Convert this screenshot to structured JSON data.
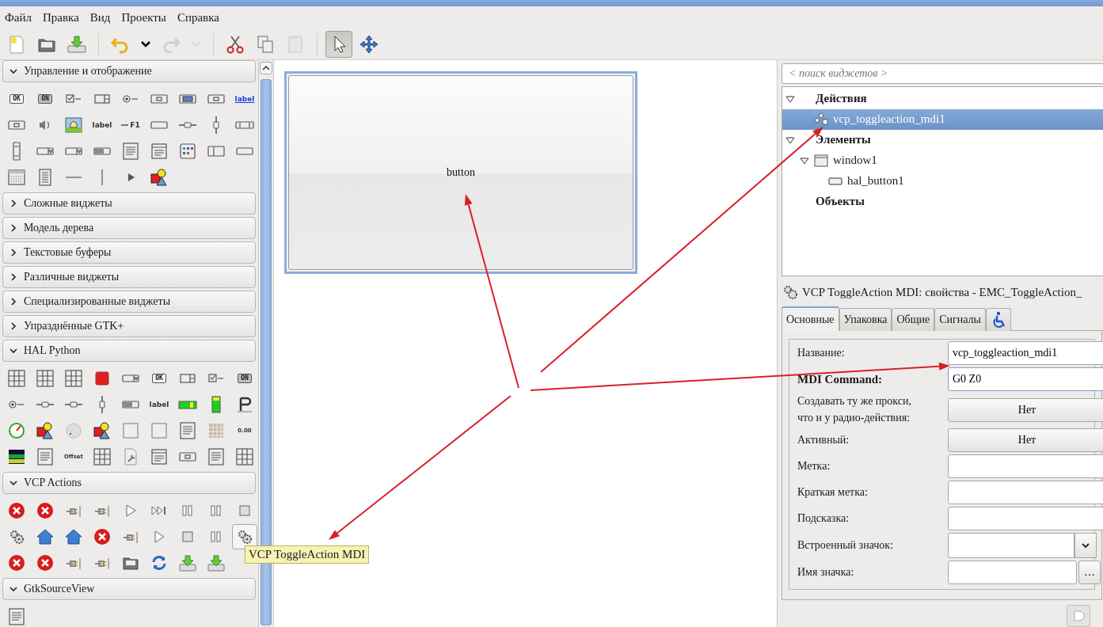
{
  "menu": [
    {
      "label": "Файл"
    },
    {
      "label": "Правка"
    },
    {
      "label": "Вид"
    },
    {
      "label": "Проекты"
    },
    {
      "label": "Справка"
    }
  ],
  "toolbar": [
    {
      "kind": "new",
      "disabled": false,
      "selected": false
    },
    {
      "kind": "open",
      "disabled": false,
      "selected": false
    },
    {
      "kind": "save",
      "disabled": false,
      "selected": false
    },
    {
      "kind": "separator"
    },
    {
      "kind": "undo",
      "disabled": false,
      "selected": false
    },
    {
      "kind": "caret",
      "disabled": false,
      "selected": false
    },
    {
      "kind": "redo",
      "disabled": true,
      "selected": false
    },
    {
      "kind": "caret",
      "disabled": true,
      "selected": false
    },
    {
      "kind": "separator"
    },
    {
      "kind": "cut",
      "disabled": false,
      "selected": false
    },
    {
      "kind": "copy",
      "disabled": false,
      "selected": false
    },
    {
      "kind": "paste",
      "disabled": true,
      "selected": false
    },
    {
      "kind": "separator"
    },
    {
      "kind": "pointer",
      "disabled": false,
      "selected": true
    },
    {
      "kind": "move",
      "disabled": false,
      "selected": false
    }
  ],
  "palette": [
    {
      "title": "Управление и отображение",
      "expanded": true,
      "items": [
        {
          "kind": "button",
          "text": "OK"
        },
        {
          "kind": "toggle",
          "text": "ON"
        },
        {
          "kind": "check"
        },
        {
          "kind": "spin"
        },
        {
          "kind": "radio"
        },
        {
          "kind": "framebtn"
        },
        {
          "kind": "colorbtn"
        },
        {
          "kind": "fontbtn"
        },
        {
          "kind": "link",
          "text": "label"
        },
        {
          "kind": "scalebtn"
        },
        {
          "kind": "volume"
        },
        {
          "kind": "image"
        },
        {
          "kind": "label",
          "text": "label"
        },
        {
          "kind": "accel",
          "text": "F1"
        },
        {
          "kind": "entry"
        },
        {
          "kind": "hscale"
        },
        {
          "kind": "vscale"
        },
        {
          "kind": "hscroll"
        },
        {
          "kind": "vscroll"
        },
        {
          "kind": "combo"
        },
        {
          "kind": "combo"
        },
        {
          "kind": "progress"
        },
        {
          "kind": "doc"
        },
        {
          "kind": "window"
        },
        {
          "kind": "iconview"
        },
        {
          "kind": "paned"
        },
        {
          "kind": "bar"
        },
        {
          "kind": "calendar"
        },
        {
          "kind": "list"
        },
        {
          "kind": "hsep"
        },
        {
          "kind": "vsep"
        },
        {
          "kind": "arrow"
        },
        {
          "kind": "shapes"
        }
      ]
    },
    {
      "title": "Сложные виджеты",
      "expanded": false
    },
    {
      "title": "Модель дерева",
      "expanded": false
    },
    {
      "title": "Текстовые буферы",
      "expanded": false
    },
    {
      "title": "Различные виджеты",
      "expanded": false
    },
    {
      "title": "Специализированные виджеты",
      "expanded": false
    },
    {
      "title": "Упразднённые GTK+",
      "expanded": false
    },
    {
      "title": "HAL Python",
      "expanded": true,
      "items": [
        {
          "kind": "grid"
        },
        {
          "kind": "grid"
        },
        {
          "kind": "grid"
        },
        {
          "kind": "redsquare"
        },
        {
          "kind": "combo"
        },
        {
          "kind": "button",
          "text": "OK"
        },
        {
          "kind": "spin"
        },
        {
          "kind": "check"
        },
        {
          "kind": "toggle",
          "text": "ON"
        },
        {
          "kind": "radio"
        },
        {
          "kind": "hscale"
        },
        {
          "kind": "hscale"
        },
        {
          "kind": "vscale"
        },
        {
          "kind": "progress"
        },
        {
          "kind": "label",
          "text": "label"
        },
        {
          "kind": "barh"
        },
        {
          "kind": "barv"
        },
        {
          "kind": "pcorner"
        },
        {
          "kind": "gauge"
        },
        {
          "kind": "shapes"
        },
        {
          "kind": "dial"
        },
        {
          "kind": "shapes"
        },
        {
          "kind": "tile"
        },
        {
          "kind": "tile"
        },
        {
          "kind": "doc"
        },
        {
          "kind": "mesh"
        },
        {
          "kind": "value",
          "text": "0.00"
        },
        {
          "kind": "graph"
        },
        {
          "kind": "sheet"
        },
        {
          "kind": "value",
          "text": "Offset"
        },
        {
          "kind": "table"
        },
        {
          "kind": "tool"
        },
        {
          "kind": "window"
        },
        {
          "kind": "framebtn"
        },
        {
          "kind": "doc"
        },
        {
          "kind": "table"
        }
      ]
    },
    {
      "title": "VCP Actions",
      "expanded": true,
      "items": [
        {
          "kind": "error"
        },
        {
          "kind": "error"
        },
        {
          "kind": "plug"
        },
        {
          "kind": "plug"
        },
        {
          "kind": "play"
        },
        {
          "kind": "ffwd"
        },
        {
          "kind": "pause"
        },
        {
          "kind": "pause"
        },
        {
          "kind": "stop"
        },
        {
          "kind": "gears"
        },
        {
          "kind": "home"
        },
        {
          "kind": "home"
        },
        {
          "kind": "error"
        },
        {
          "kind": "plug"
        },
        {
          "kind": "play"
        },
        {
          "kind": "stop"
        },
        {
          "kind": "pause"
        },
        {
          "kind": "gears",
          "selected": true
        },
        {
          "kind": "error"
        },
        {
          "kind": "error"
        },
        {
          "kind": "plug"
        },
        {
          "kind": "plug"
        },
        {
          "kind": "folder"
        },
        {
          "kind": "refresh"
        },
        {
          "kind": "download"
        },
        {
          "kind": "download"
        }
      ]
    },
    {
      "title": "GtkSourceView",
      "expanded": true,
      "items": [
        {
          "kind": "doc"
        }
      ]
    }
  ],
  "tooltip": {
    "text": "VCP ToggleAction MDI"
  },
  "canvas": {
    "button": {
      "label": "button"
    }
  },
  "search": {
    "placeholder": "< поиск виджетов >"
  },
  "tree": [
    {
      "label": "Действия",
      "bold": true,
      "expanded": true,
      "selected": false,
      "children": [
        {
          "label": "vcp_toggleaction_mdi1",
          "bold": false,
          "selected": true,
          "kind": "action"
        }
      ]
    },
    {
      "label": "Элементы",
      "bold": true,
      "expanded": true,
      "selected": false,
      "children": [
        {
          "label": "window1",
          "bold": false,
          "expanded": true,
          "selected": false,
          "kind": "window",
          "children": [
            {
              "label": "hal_button1",
              "bold": false,
              "selected": false,
              "kind": "button"
            }
          ]
        }
      ]
    },
    {
      "label": "Объекты",
      "bold": true,
      "selected": false
    }
  ],
  "properties": {
    "title": "VCP ToggleAction MDI: свойства - EMC_ToggleAction_",
    "tabs": [
      {
        "label": "Основные",
        "kind": "text",
        "selected": true
      },
      {
        "label": "Упаковка",
        "kind": "text",
        "selected": false
      },
      {
        "label": "Общие",
        "kind": "text",
        "selected": false
      },
      {
        "label": "Сигналы",
        "kind": "text",
        "selected": false
      },
      {
        "kind": "accessibility",
        "selected": false
      }
    ],
    "rows": [
      {
        "label": "Название:",
        "bold": false,
        "kind": "entry",
        "value": "vcp_toggleaction_mdi1",
        "focused": false
      },
      {
        "label": "MDI Command:",
        "bold": true,
        "kind": "entry",
        "value": "G0 Z0",
        "focused": true
      },
      {
        "label": "Создавать ту же прокси,\nчто и у радио-действия:",
        "bold": false,
        "kind": "toggle",
        "value": "Нет"
      },
      {
        "label": "Активный:",
        "bold": false,
        "kind": "toggle",
        "value": "Нет"
      },
      {
        "label": "Метка:",
        "bold": false,
        "kind": "entry",
        "focused": false
      },
      {
        "label": "Краткая метка:",
        "bold": false,
        "kind": "entry",
        "focused": false
      },
      {
        "label": "Подсказка:",
        "bold": false,
        "kind": "entry",
        "focused": false
      },
      {
        "label": "Встроенный значок:",
        "bold": false,
        "kind": "combo"
      },
      {
        "label": "Имя значка:",
        "bold": false,
        "kind": "entry-button",
        "button": "…"
      }
    ]
  }
}
